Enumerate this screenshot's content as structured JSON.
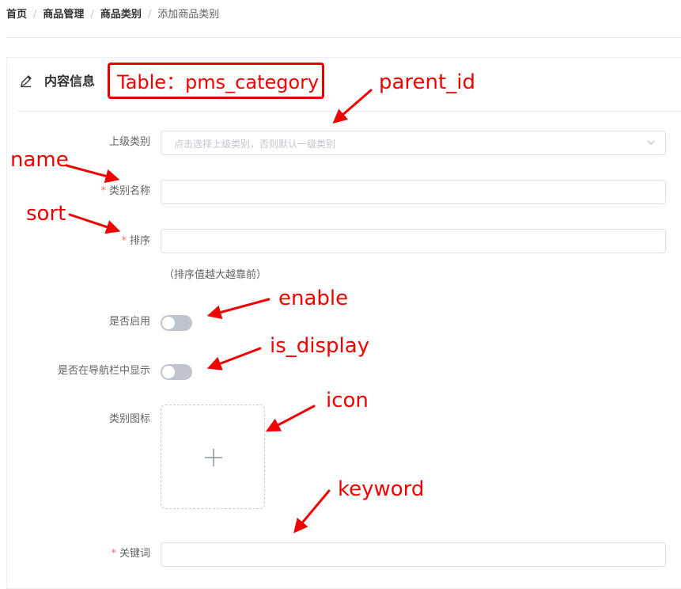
{
  "breadcrumb": {
    "items": [
      "首页",
      "商品管理",
      "商品类别",
      "添加商品类别"
    ],
    "separator": "/"
  },
  "card": {
    "title": "内容信息",
    "title_icon": "edit-pencil-icon"
  },
  "annotations": {
    "table": "Table：pms_category",
    "parent_id": "parent_id",
    "name": "name",
    "sort": "sort",
    "enable": "enable",
    "is_display": "is_display",
    "icon": "icon",
    "keyword": "keyword"
  },
  "form": {
    "parent": {
      "label": "上级类别",
      "placeholder": "点击选择上级类别，否则默认一级类别",
      "icon": "chevron-down-icon"
    },
    "name": {
      "label": "类别名称",
      "required": "*",
      "value": ""
    },
    "sort": {
      "label": "排序",
      "required": "*",
      "value": "",
      "hint": "（排序值越大越靠前）"
    },
    "enable": {
      "label": "是否启用",
      "checked": false
    },
    "nav_display": {
      "label": "是否在导航栏中显示",
      "checked": false
    },
    "icon_upload": {
      "label": "类别图标",
      "icon": "plus-icon"
    },
    "keyword": {
      "label": "关键词",
      "required": "*",
      "value": ""
    }
  },
  "colors": {
    "annotation_red": "#f10000",
    "required_star": "#f56c6c",
    "switch_off": "#c0c4cc",
    "border": "#dcdfe6"
  }
}
